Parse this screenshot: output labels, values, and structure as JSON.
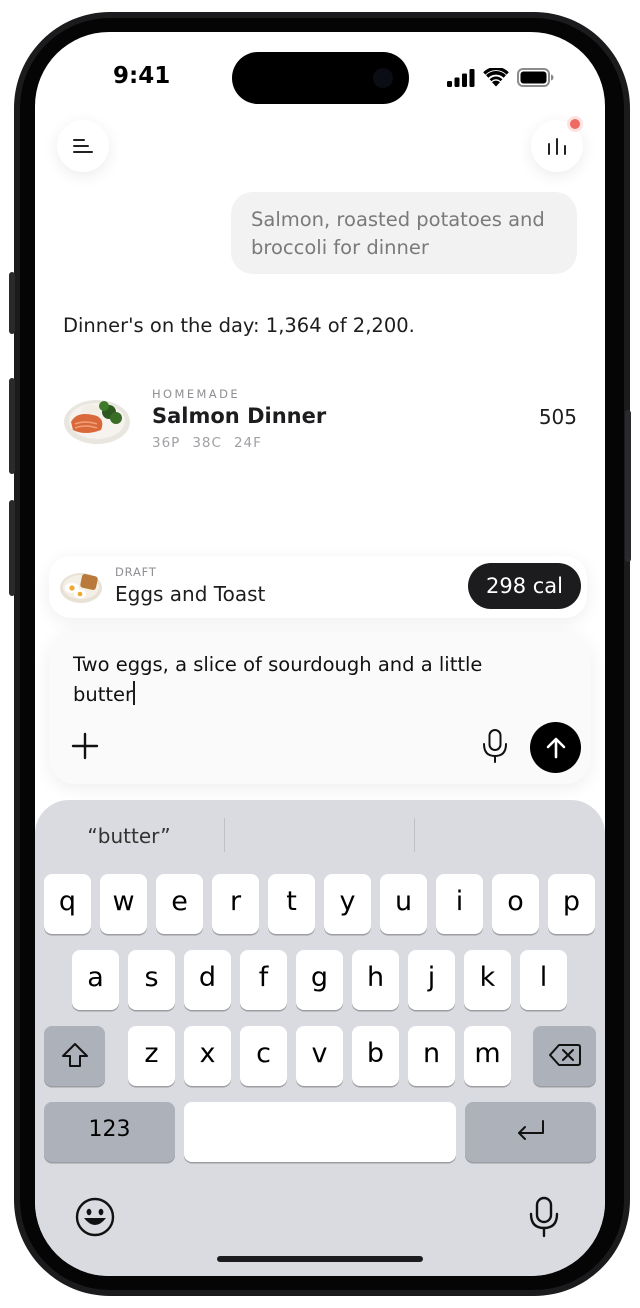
{
  "status_bar": {
    "time": "9:41",
    "icons": [
      "cellular-signal-icon",
      "wifi-icon",
      "battery-icon"
    ]
  },
  "header": {
    "menu_icon": "menu-icon",
    "stats_icon": "bar-chart-icon",
    "has_notification": true,
    "notification_color": "#ef6a64"
  },
  "chat": {
    "user_message": "Salmon, roasted potatoes and broccoli for dinner",
    "summary": "Dinner's on the day: 1,364 of 2,200."
  },
  "logged_food": {
    "source": "HOMEMADE",
    "name": "Salmon Dinner",
    "macros": [
      "36P",
      "38C",
      "24F"
    ],
    "calories": "505"
  },
  "draft": {
    "label": "DRAFT",
    "name": "Eggs and Toast",
    "calories": "298 cal"
  },
  "composer": {
    "text": "Two eggs, a slice of sourdough and a little butter",
    "buttons": [
      "plus-icon",
      "microphone-icon",
      "send-arrow-icon"
    ]
  },
  "keyboard": {
    "suggestions": [
      "“butter”",
      "",
      ""
    ],
    "row1": [
      "q",
      "w",
      "e",
      "r",
      "t",
      "y",
      "u",
      "i",
      "o",
      "p"
    ],
    "row2": [
      "a",
      "s",
      "d",
      "f",
      "g",
      "h",
      "j",
      "k",
      "l"
    ],
    "row3": [
      "z",
      "x",
      "c",
      "v",
      "b",
      "n",
      "m"
    ],
    "numbers_key": "123",
    "space_key": "",
    "bottom_icons": [
      "emoji-icon",
      "dictation-icon"
    ]
  },
  "colors": {
    "accent_dark": "#1c1c1e",
    "bubble": "#f2f2f2",
    "keyboard_bg": "#d9dbe0"
  }
}
